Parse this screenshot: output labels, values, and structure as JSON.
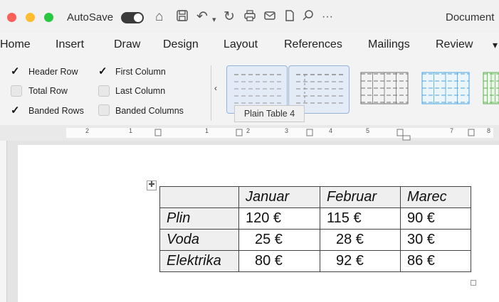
{
  "window": {
    "autosave_label": "AutoSave",
    "document_title": "Document"
  },
  "quick_toolbar": {
    "more_label": "···"
  },
  "tabs": [
    "Home",
    "Insert",
    "Draw",
    "Design",
    "Layout",
    "References",
    "Mailings",
    "Review"
  ],
  "table_style_options": [
    {
      "label": "Header Row",
      "checked": true
    },
    {
      "label": "Total Row",
      "checked": false
    },
    {
      "label": "Banded Rows",
      "checked": true
    },
    {
      "label": "First Column",
      "checked": true
    },
    {
      "label": "Last Column",
      "checked": false
    },
    {
      "label": "Banded Columns",
      "checked": false
    }
  ],
  "table_styles": {
    "tooltip": "Plain Table 4",
    "accent_colors": [
      "#999999",
      "#888888",
      "#6f6f6f",
      "#4aa3df",
      "#58b24d"
    ]
  },
  "ruler": {
    "numbers": [
      "2",
      "1",
      "1",
      "2",
      "3",
      "4",
      "5",
      "7",
      "8"
    ]
  },
  "document_table": {
    "header": [
      "",
      "Januar",
      "Februar",
      "Marec"
    ],
    "rows": [
      [
        "Plin",
        "120 €",
        "115 €",
        "90 €"
      ],
      [
        "Voda",
        "25 €",
        "28 €",
        "30 €"
      ],
      [
        "Elektrika",
        "80 €",
        "92 €",
        "86 €"
      ]
    ]
  }
}
